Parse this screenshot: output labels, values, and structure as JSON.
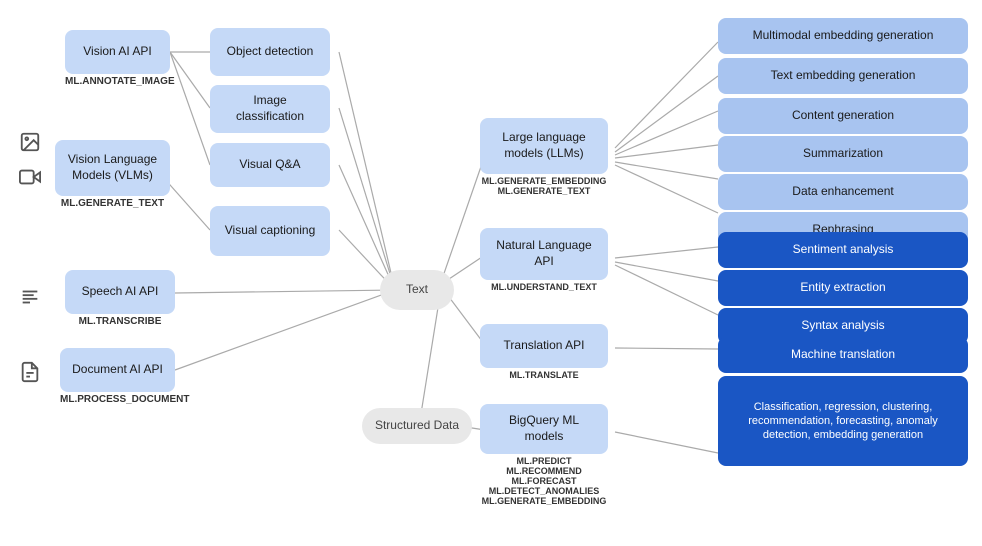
{
  "nodes": {
    "visionApi": {
      "label": "Vision AI API",
      "sub": "ML.ANNOTATE_IMAGE"
    },
    "visionLang": {
      "label": "Vision Language Models (VLMs)",
      "sub": "ML.GENERATE_TEXT"
    },
    "speechApi": {
      "label": "Speech AI API",
      "sub": "ML.TRANSCRIBE"
    },
    "docApi": {
      "label": "Document AI API",
      "sub": "ML.PROCESS_DOCUMENT"
    },
    "objDetect": {
      "label": "Object detection"
    },
    "imgClass": {
      "label": "Image classification"
    },
    "visualQA": {
      "label": "Visual Q&A"
    },
    "visualCaption": {
      "label": "Visual captioning"
    },
    "textNode": {
      "label": "Text"
    },
    "structuredData": {
      "label": "Structured Data"
    },
    "llm": {
      "label": "Large language models (LLMs)",
      "sub": "ML.GENERATE_EMBEDDING\nML.GENERATE_TEXT"
    },
    "nlpApi": {
      "label": "Natural Language API",
      "sub": "ML.UNDERSTAND_TEXT"
    },
    "transApi": {
      "label": "Translation API",
      "sub": "ML.TRANSLATE"
    },
    "bigqueryML": {
      "label": "BigQuery ML models",
      "sub": "ML.PREDICT\nML.RECOMMEND\nML.FORECAST\nML.DETECT_ANOMALIES\nML.GENERATE_EMBEDDING"
    },
    "multimodalEmbed": {
      "label": "Multimodal embedding generation"
    },
    "textEmbed": {
      "label": "Text embedding generation"
    },
    "contentGen": {
      "label": "Content generation"
    },
    "summarization": {
      "label": "Summarization"
    },
    "dataEnhancement": {
      "label": "Data enhancement"
    },
    "rephrasing": {
      "label": "Rephrasing"
    },
    "sentimentAnalysis": {
      "label": "Sentiment analysis"
    },
    "entityExtraction": {
      "label": "Entity extraction"
    },
    "syntaxAnalysis": {
      "label": "Syntax analysis"
    },
    "machineTranslation": {
      "label": "Machine translation"
    },
    "classificationBox": {
      "label": "Classification, regression, clustering, recommendation, forecasting, anomaly detection, embedding generation"
    }
  }
}
